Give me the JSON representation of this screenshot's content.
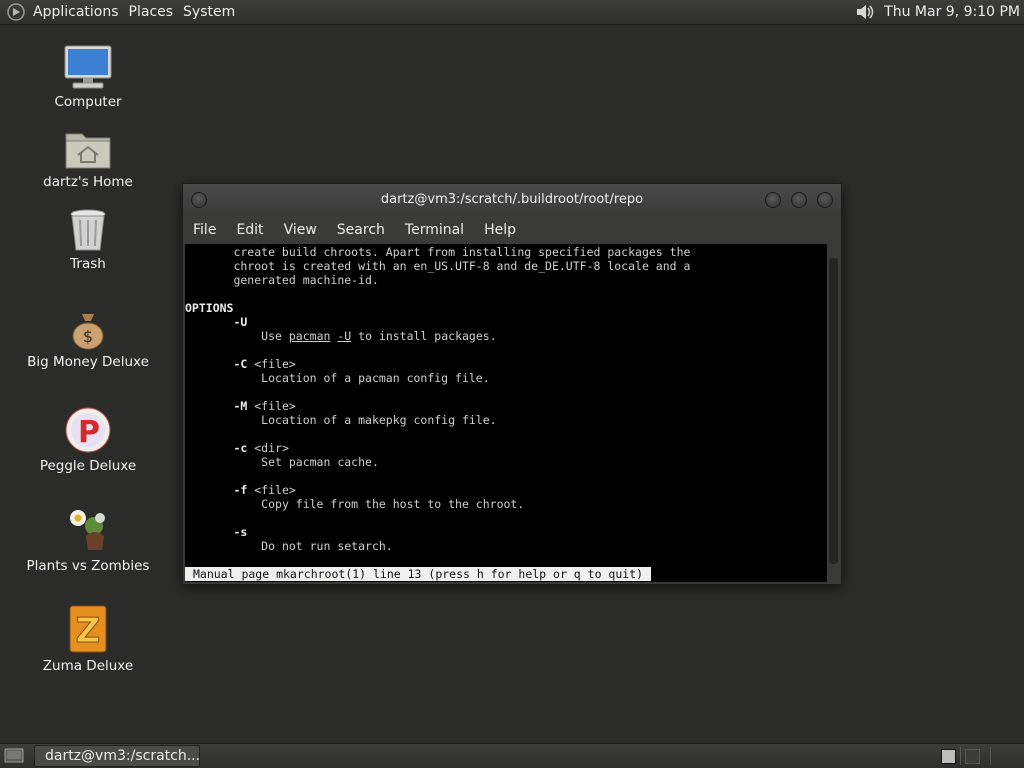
{
  "top_panel": {
    "menus": [
      "Applications",
      "Places",
      "System"
    ],
    "clock": "Thu Mar  9,  9:10 PM"
  },
  "desktop_icons": [
    {
      "label": "Computer",
      "icon": "computer-icon"
    },
    {
      "label": "dartz's Home",
      "icon": "home-folder-icon"
    },
    {
      "label": "Trash",
      "icon": "trash-icon"
    },
    {
      "label": "Big Money Deluxe",
      "icon": "money-bag-icon"
    },
    {
      "label": "Peggle Deluxe",
      "icon": "peggle-icon"
    },
    {
      "label": "Plants vs Zombies",
      "icon": "plants-vs-zombies-icon"
    },
    {
      "label": "Zuma Deluxe",
      "icon": "zuma-icon"
    }
  ],
  "window": {
    "title": "dartz@vm3:/scratch/.buildroot/root/repo",
    "menus": [
      "File",
      "Edit",
      "View",
      "Search",
      "Terminal",
      "Help"
    ],
    "terminal": {
      "intro": [
        "       create build chroots. Apart from installing specified packages the",
        "       chroot is created with an en_US.UTF-8 and de_DE.UTF-8 locale and a",
        "       generated machine-id."
      ],
      "section_header": "OPTIONS",
      "opt_u_flag": "-U",
      "opt_u_prefix": "Use ",
      "opt_u_cmd": "pacman",
      "opt_u_arg": "-U",
      "opt_u_suffix": " to install packages.",
      "options": [
        {
          "flag": "-C",
          "arg": " <file>",
          "desc": "Location of a pacman config file."
        },
        {
          "flag": "-M",
          "arg": " <file>",
          "desc": "Location of a makepkg config file."
        },
        {
          "flag": "-c",
          "arg": " <dir>",
          "desc": "Set pacman cache."
        },
        {
          "flag": "-f",
          "arg": " <file>",
          "desc": "Copy file from the host to the chroot."
        },
        {
          "flag": "-s",
          "arg": "",
          "desc": "Do not run setarch."
        }
      ],
      "status": "Manual page mkarchroot(1) line 13 (press h for help or q to quit)"
    }
  },
  "taskbar": {
    "task_label": "dartz@vm3:/scratch..."
  }
}
